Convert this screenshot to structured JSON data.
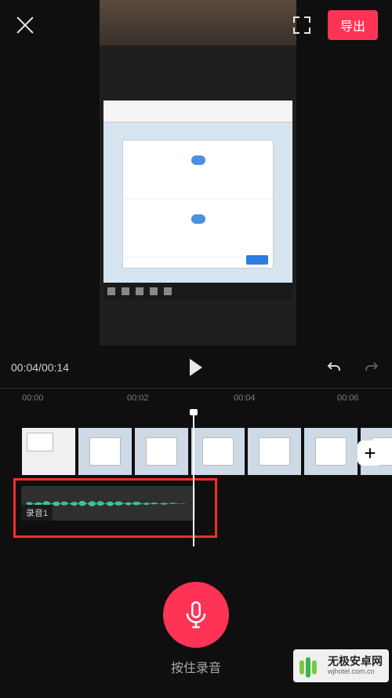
{
  "header": {
    "export_label": "导出"
  },
  "playback": {
    "current_time": "00:04",
    "total_time": "00:14"
  },
  "timeline": {
    "ticks": [
      "00:00",
      "00:02",
      "00:04",
      "00:06"
    ],
    "ticks_pos": [
      28,
      162,
      298,
      430
    ],
    "audio_track_label": "录音1",
    "add_label": "+"
  },
  "record": {
    "hint": "按住录音"
  },
  "watermark": {
    "title": "无极安卓网",
    "subtitle": "wjhotel.com.cn"
  }
}
